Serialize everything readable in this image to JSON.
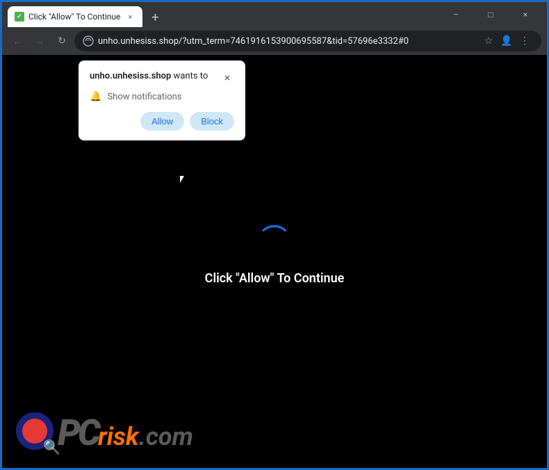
{
  "browser": {
    "tab": {
      "favicon_color": "#4CAF50",
      "title": "Click \"Allow\" To Continue",
      "close_label": "×"
    },
    "new_tab_label": "+",
    "window_controls": {
      "minimize": "−",
      "maximize": "□",
      "close": "×"
    },
    "nav": {
      "back_icon": "←",
      "forward_icon": "→",
      "refresh_icon": "↻",
      "url": "unho.unhesiss.shop/?utm_term=7461916153900695587&tid=57696e3332#0",
      "bookmark_icon": "☆",
      "profile_icon": "👤",
      "menu_icon": "⋮"
    }
  },
  "notification_popup": {
    "title_text": " wants to",
    "site_name": "unho.unhesiss.shop",
    "permission_label": "Show notifications",
    "allow_label": "Allow",
    "block_label": "Block",
    "close_label": "×"
  },
  "page_content": {
    "loading_text": "Click \"Allow\" To Continue",
    "spinner_color": "#1a73e8"
  },
  "watermark": {
    "pc_letters": "PC",
    "risk_text": "risk",
    "dot_com": ".com"
  }
}
